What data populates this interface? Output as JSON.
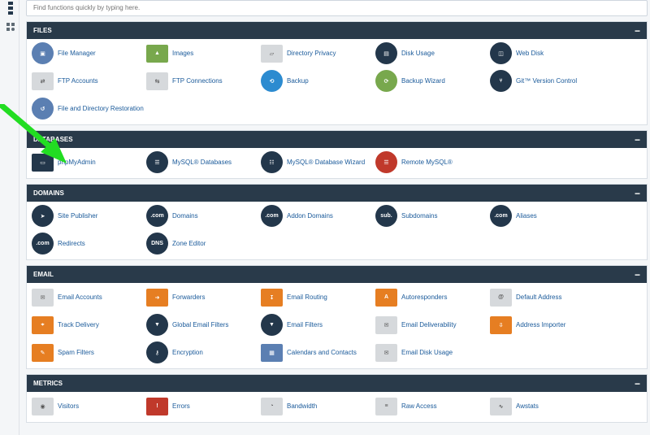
{
  "search": {
    "placeholder": "Find functions quickly by typing here."
  },
  "panels": [
    {
      "title": "FILES",
      "collapse": "−",
      "items": [
        {
          "label": "File Manager",
          "icon": "file-manager-icon"
        },
        {
          "label": "Images",
          "icon": "images-icon"
        },
        {
          "label": "Directory Privacy",
          "icon": "folder-icon"
        },
        {
          "label": "Disk Usage",
          "icon": "disk-usage-icon"
        },
        {
          "label": "Web Disk",
          "icon": "web-disk-icon"
        },
        {
          "label": "FTP Accounts",
          "icon": "ftp-accounts-icon"
        },
        {
          "label": "FTP Connections",
          "icon": "ftp-connections-icon"
        },
        {
          "label": "Backup",
          "icon": "backup-icon"
        },
        {
          "label": "Backup Wizard",
          "icon": "backup-wizard-icon"
        },
        {
          "label": "Git™ Version Control",
          "icon": "git-icon"
        },
        {
          "label": "File and Directory Restoration",
          "icon": "restore-icon"
        }
      ]
    },
    {
      "title": "DATABASES",
      "collapse": "−",
      "items": [
        {
          "label": "phpMyAdmin",
          "icon": "phpmyadmin-icon"
        },
        {
          "label": "MySQL® Databases",
          "icon": "mysql-databases-icon"
        },
        {
          "label": "MySQL® Database Wizard",
          "icon": "mysql-wizard-icon"
        },
        {
          "label": "Remote MySQL®",
          "icon": "remote-mysql-icon"
        }
      ]
    },
    {
      "title": "DOMAINS",
      "collapse": "−",
      "items": [
        {
          "label": "Site Publisher",
          "icon": "site-publisher-icon"
        },
        {
          "label": "Domains",
          "icon": "domains-icon"
        },
        {
          "label": "Addon Domains",
          "icon": "addon-domains-icon"
        },
        {
          "label": "Subdomains",
          "icon": "subdomains-icon"
        },
        {
          "label": "Aliases",
          "icon": "aliases-icon"
        },
        {
          "label": "Redirects",
          "icon": "redirects-icon"
        },
        {
          "label": "Zone Editor",
          "icon": "dns-icon"
        }
      ]
    },
    {
      "title": "EMAIL",
      "collapse": "−",
      "items": [
        {
          "label": "Email Accounts",
          "icon": "email-accounts-icon"
        },
        {
          "label": "Forwarders",
          "icon": "forwarders-icon"
        },
        {
          "label": "Email Routing",
          "icon": "email-routing-icon"
        },
        {
          "label": "Autoresponders",
          "icon": "autoresponders-icon"
        },
        {
          "label": "Default Address",
          "icon": "default-address-icon"
        },
        {
          "label": "Track Delivery",
          "icon": "track-delivery-icon"
        },
        {
          "label": "Global Email Filters",
          "icon": "global-filters-icon"
        },
        {
          "label": "Email Filters",
          "icon": "email-filters-icon"
        },
        {
          "label": "Email Deliverability",
          "icon": "email-deliverability-icon"
        },
        {
          "label": "Address Importer",
          "icon": "address-importer-icon"
        },
        {
          "label": "Spam Filters",
          "icon": "spam-filters-icon"
        },
        {
          "label": "Encryption",
          "icon": "encryption-icon"
        },
        {
          "label": "Calendars and Contacts",
          "icon": "calendar-icon"
        },
        {
          "label": "Email Disk Usage",
          "icon": "email-disk-usage-icon"
        }
      ]
    },
    {
      "title": "METRICS",
      "collapse": "−",
      "items": [
        {
          "label": "Visitors",
          "icon": "visitors-icon"
        },
        {
          "label": "Errors",
          "icon": "errors-icon"
        },
        {
          "label": "Bandwidth",
          "icon": "bandwidth-icon"
        },
        {
          "label": "Raw Access",
          "icon": "raw-access-icon"
        },
        {
          "label": "Awstats",
          "icon": "awstats-icon"
        }
      ]
    }
  ],
  "colors": {
    "header": "#293a4a",
    "link": "#1a5a9a",
    "arrow": "#22dd22"
  }
}
